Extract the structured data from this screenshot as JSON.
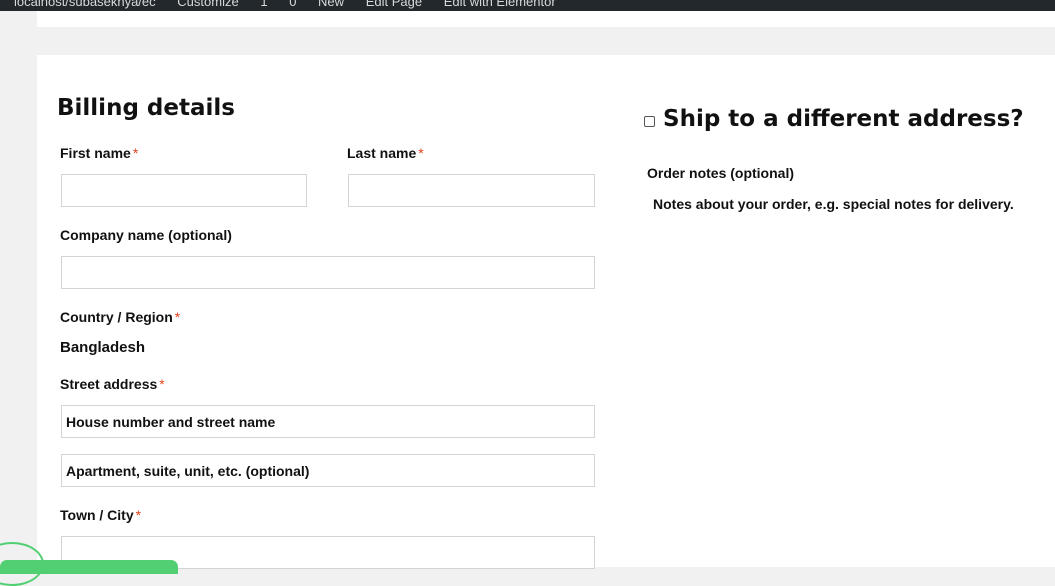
{
  "admin_bar": {
    "items": [
      "localhost/subasekhya/ec",
      "Customize",
      "1",
      "0",
      "New",
      "Edit Page",
      "Edit with Elementor"
    ]
  },
  "billing": {
    "title": "Billing details",
    "required_mark": "*",
    "first_name_label": "First name",
    "last_name_label": "Last name",
    "company_label": "Company name (optional)",
    "country_label": "Country / Region",
    "country_value": "Bangladesh",
    "street_label": "Street address",
    "street_placeholder": "House number and street name",
    "apartment_placeholder": "Apartment, suite, unit, etc. (optional)",
    "city_label": "Town / City"
  },
  "shipping": {
    "ship_different_label": "Ship to a different address?",
    "order_notes_label": "Order notes (optional)",
    "order_notes_placeholder": "Notes about your order, e.g. special notes for delivery."
  },
  "colors": {
    "admin_bar": "#23282d",
    "required": "#e2401c",
    "accent_green": "#52cf72",
    "border": "#d4d4d4"
  }
}
